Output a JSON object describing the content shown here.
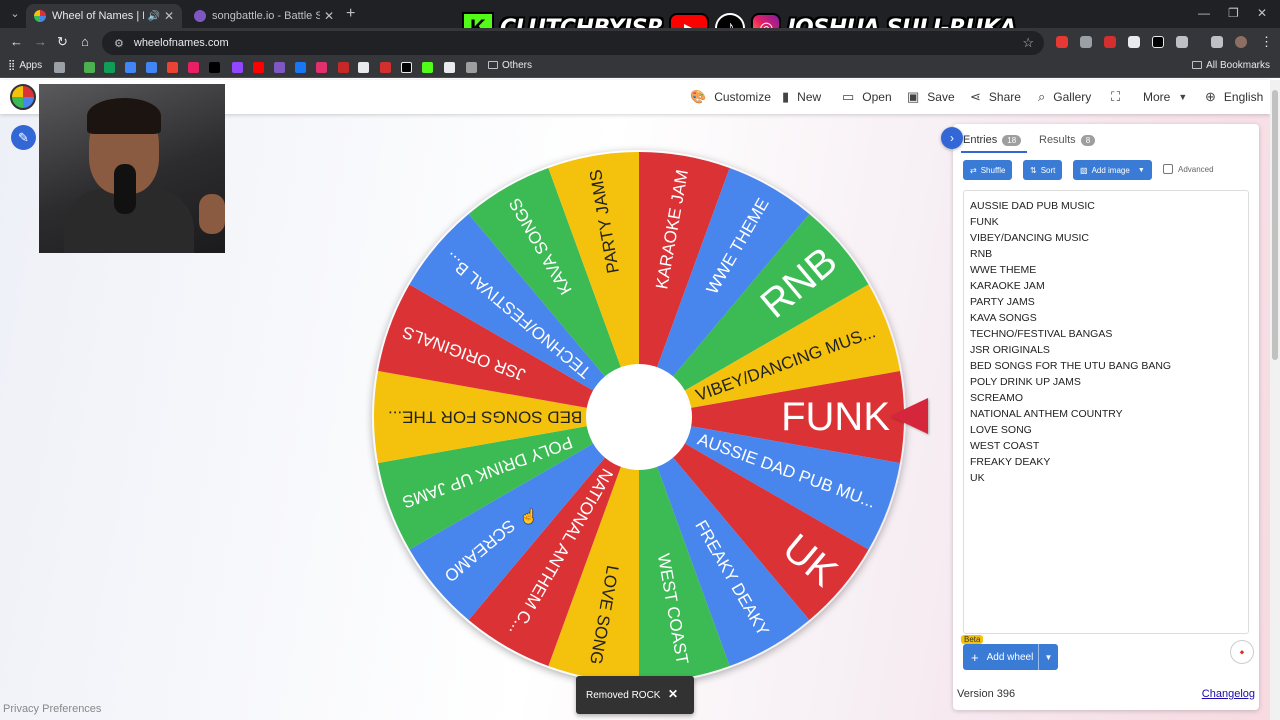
{
  "browser": {
    "tabs": [
      {
        "title": "Wheel of Names | Random",
        "active": true
      },
      {
        "title": "songbattle.io - Battle Songs ag",
        "active": false
      }
    ],
    "url": "wheelofnames.com",
    "bookmarks": {
      "apps_label": "Apps",
      "others_label": "Others",
      "all_label": "All Bookmarks"
    }
  },
  "banner": {
    "kick_handle": "CLUTCHBYJSR",
    "name": "JOSHUA SULI-RUKA"
  },
  "nav": {
    "customize": "Customize",
    "new": "New",
    "open": "Open",
    "save": "Save",
    "share": "Share",
    "gallery": "Gallery",
    "more": "More",
    "language": "English"
  },
  "wheel": {
    "segments": [
      {
        "label": "FUNK",
        "color": "#db3236"
      },
      {
        "label": "AUSSIE DAD PUB MU...",
        "color": "#4885ed"
      },
      {
        "label": "UK",
        "color": "#db3236"
      },
      {
        "label": "FREAKY DEAKY",
        "color": "#4885ed"
      },
      {
        "label": "WEST COAST",
        "color": "#3cba54"
      },
      {
        "label": "LOVE SONG",
        "color": "#f4c20d"
      },
      {
        "label": "NATIONAL ANTHEM C...",
        "color": "#db3236"
      },
      {
        "label": "SCREAMO",
        "color": "#4885ed"
      },
      {
        "label": "POLY DRINK UP JAMS",
        "color": "#3cba54"
      },
      {
        "label": "BED SONGS FOR THE...",
        "color": "#f4c20d"
      },
      {
        "label": "JSR ORIGINALS",
        "color": "#db3236"
      },
      {
        "label": "TECHNO/FESTIVAL B...",
        "color": "#4885ed"
      },
      {
        "label": "KAVA SONGS",
        "color": "#3cba54"
      },
      {
        "label": "PARTY JAMS",
        "color": "#f4c20d"
      },
      {
        "label": "KARAOKE JAM",
        "color": "#db3236"
      },
      {
        "label": "WWE THEME",
        "color": "#4885ed"
      },
      {
        "label": "RNB",
        "color": "#3cba54"
      },
      {
        "label": "VIBEY/DANCING MUS...",
        "color": "#f4c20d"
      }
    ]
  },
  "panel": {
    "entries_tab": "Entries",
    "entries_count": "18",
    "results_tab": "Results",
    "results_count": "8",
    "shuffle": "Shuffle",
    "sort": "Sort",
    "add_image": "Add image",
    "advanced": "Advanced",
    "entries": [
      "AUSSIE DAD PUB MUSIC",
      "FUNK",
      "VIBEY/DANCING MUSIC",
      "RNB",
      "WWE THEME",
      "KARAOKE JAM",
      "PARTY JAMS",
      "KAVA SONGS",
      "TECHNO/FESTIVAL BANGAS",
      "JSR ORIGINALS",
      "BED SONGS FOR THE UTU BANG BANG",
      "POLY DRINK UP JAMS",
      "SCREAMO",
      "NATIONAL ANTHEM COUNTRY",
      "LOVE SONG",
      "WEST COAST",
      "FREAKY DEAKY",
      "UK"
    ],
    "beta": "Beta",
    "add_wheel": "Add wheel",
    "version": "Version 396",
    "changelog": "Changelog"
  },
  "privacy": "Privacy Preferences",
  "toast": "Removed ROCK"
}
